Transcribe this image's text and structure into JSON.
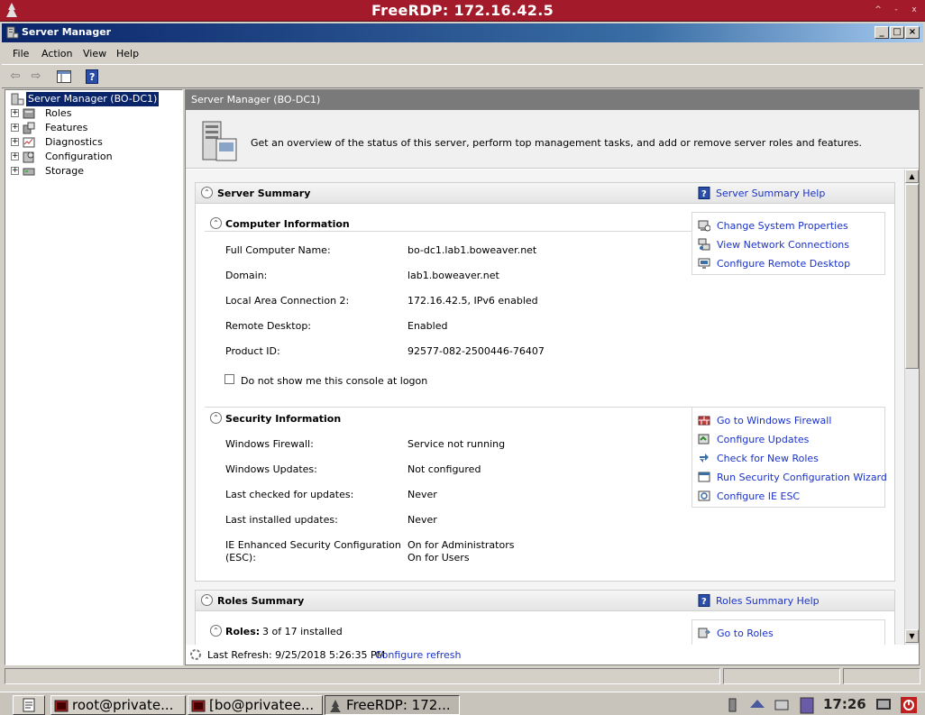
{
  "outer_window": {
    "title": "FreeRDP: 172.16.42.5",
    "controls": [
      "^",
      "-",
      "x"
    ]
  },
  "app": {
    "title": "Server Manager"
  },
  "menu": [
    "File",
    "Action",
    "View",
    "Help"
  ],
  "tree": {
    "root": "Server Manager (BO-DC1)",
    "items": [
      "Roles",
      "Features",
      "Diagnostics",
      "Configuration",
      "Storage"
    ]
  },
  "content": {
    "header": "Server Manager (BO-DC1)",
    "intro": "Get an overview of the status of this server, perform top management tasks, and add or remove server roles and features."
  },
  "server_summary": {
    "title": "Server Summary",
    "help_link": "Server Summary Help",
    "computer_info": {
      "title": "Computer Information",
      "rows": [
        {
          "label": "Full Computer Name:",
          "value": "bo-dc1.lab1.boweaver.net"
        },
        {
          "label": "Domain:",
          "value": "lab1.boweaver.net"
        },
        {
          "label": "Local Area Connection 2:",
          "value": "172.16.42.5, IPv6 enabled"
        },
        {
          "label": "Remote Desktop:",
          "value": "Enabled"
        },
        {
          "label": "Product ID:",
          "value": "92577-082-2500446-76407"
        }
      ],
      "checkbox_label": "Do not show me this console at logon",
      "actions": [
        "Change System Properties",
        "View Network Connections",
        "Configure Remote Desktop"
      ]
    },
    "security_info": {
      "title": "Security Information",
      "rows": [
        {
          "label": "Windows Firewall:",
          "value": "Service not running"
        },
        {
          "label": "Windows Updates:",
          "value": "Not configured"
        },
        {
          "label": "Last checked for updates:",
          "value": "Never"
        },
        {
          "label": "Last installed updates:",
          "value": "Never"
        }
      ],
      "ie_label_1": "IE Enhanced Security Configuration",
      "ie_label_2": "(ESC):",
      "ie_value_1": "On for Administrators",
      "ie_value_2": "On for Users",
      "actions": [
        "Go to Windows Firewall",
        "Configure Updates",
        "Check for New Roles",
        "Run Security Configuration Wizard",
        "Configure IE ESC"
      ]
    }
  },
  "roles_summary": {
    "title": "Roles Summary",
    "help_link": "Roles Summary Help",
    "roles_label": "Roles:",
    "roles_count": "3 of 17 installed",
    "go_link": "Go to Roles"
  },
  "refresh": {
    "text": "Last Refresh: 9/25/2018 5:26:35 PM",
    "link": "Configure refresh"
  },
  "taskbar": {
    "tasks": [
      "root@private...",
      "[bo@privatee...",
      "FreeRDP: 172..."
    ],
    "clock": "17:26"
  },
  "colors": {
    "outer_title": "#a31a2a",
    "app_title": "#0a246a",
    "link": "#1a32c8",
    "content_header": "#7a7a7a"
  }
}
